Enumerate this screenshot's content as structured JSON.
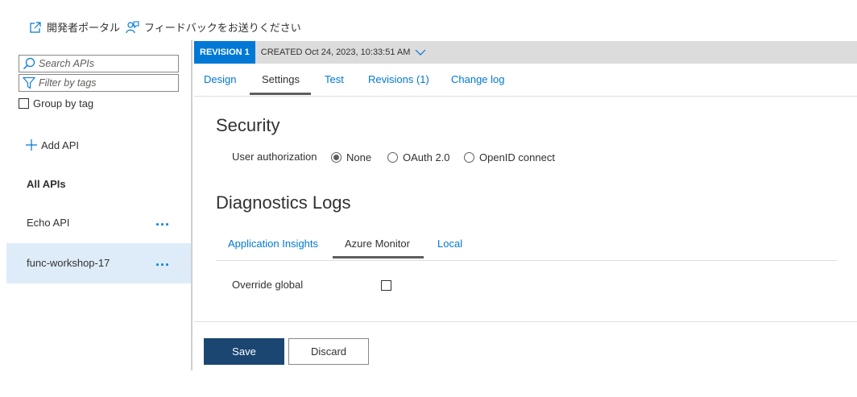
{
  "toolbar": {
    "developer_portal": "開発者ポータル",
    "feedback": "フィードバックをお送りください"
  },
  "sidebar": {
    "search_placeholder": "Search APIs",
    "filter_placeholder": "Filter by tags",
    "group_by_tag": "Group by tag",
    "add_api": "Add API",
    "all_apis": "All APIs",
    "apis": [
      {
        "name": "Echo API",
        "more": "..."
      },
      {
        "name": "func-workshop-17",
        "more": "..."
      }
    ]
  },
  "revision": {
    "badge": "REVISION 1",
    "created": "CREATED Oct 24, 2023, 10:33:51 AM"
  },
  "tabs": [
    "Design",
    "Settings",
    "Test",
    "Revisions (1)",
    "Change log"
  ],
  "security": {
    "title": "Security",
    "user_auth_label": "User authorization",
    "options": [
      "None",
      "OAuth 2.0",
      "OpenID connect"
    ],
    "selected": "None"
  },
  "diagnostics": {
    "title": "Diagnostics Logs",
    "tabs": [
      "Application Insights",
      "Azure Monitor",
      "Local"
    ],
    "active_tab": "Azure Monitor",
    "override_label": "Override global"
  },
  "buttons": {
    "save": "Save",
    "discard": "Discard"
  },
  "colors": {
    "accent": "#0078d4",
    "save_button": "#1b4672",
    "selected_row": "#deecf9",
    "revision_bar": "#dcdcdc"
  }
}
